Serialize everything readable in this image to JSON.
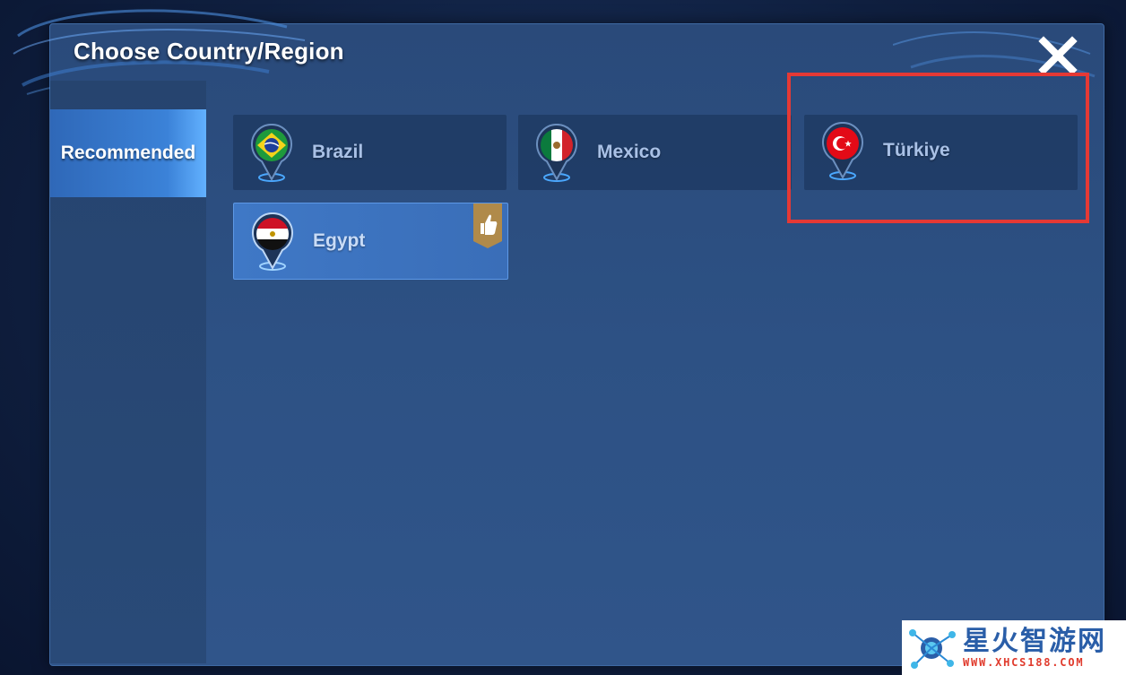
{
  "dialog": {
    "title": "Choose Country/Region",
    "close_icon": "close-x-icon"
  },
  "sidebar": {
    "tabs": [
      {
        "label": "Recommended",
        "active": true
      }
    ]
  },
  "countries": [
    {
      "name": "Brazil",
      "flag": "brazil-flag-icon",
      "selected": false,
      "recommended": false
    },
    {
      "name": "Mexico",
      "flag": "mexico-flag-icon",
      "selected": false,
      "recommended": false
    },
    {
      "name": "Türkiye",
      "flag": "turkey-flag-icon",
      "selected": false,
      "recommended": false,
      "highlighted": true
    },
    {
      "name": "Egypt",
      "flag": "egypt-flag-icon",
      "selected": true,
      "recommended": true
    }
  ],
  "colors": {
    "highlight": "#e53935",
    "accent": "#3b82d8",
    "recommend_badge": "#b08a4a"
  },
  "watermark": {
    "brand_cn": "星火智游网",
    "url": "WWW.XHCS188.COM"
  }
}
